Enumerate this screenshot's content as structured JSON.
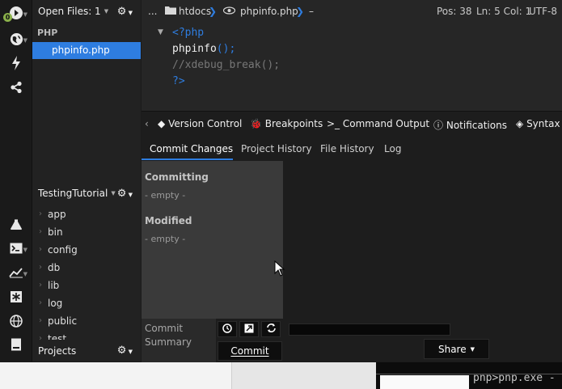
{
  "toolbar": {
    "badge": "0",
    "icons": [
      "php-toggle-icon",
      "globe-icon",
      "lightning-icon",
      "share-icon",
      "flask-icon",
      "terminal-icon",
      "chart-icon",
      "asterisk-icon",
      "globe-icon",
      "book-icon"
    ]
  },
  "left_panel": {
    "open_files_label": "Open Files: 1",
    "section_label": "PHP",
    "open_file": "phpinfo.php",
    "project_label": "TestingTutorial",
    "tree": [
      "app",
      "bin",
      "config",
      "db",
      "lib",
      "log",
      "public",
      "test"
    ],
    "projects_label": "Projects"
  },
  "editor": {
    "breadcrumb": {
      "ellipsis": "...",
      "folder": "htdocs",
      "file": "phpinfo.php",
      "dash": "–"
    },
    "status": {
      "pos": "Pos: 38",
      "ln_col": "Ln: 5 Col: 1",
      "encoding": "UTF-8"
    },
    "code": [
      "<?php",
      "phpinfo",
      "();",
      "//xdebug_break();",
      "?>"
    ]
  },
  "bottom_panel": {
    "tabs": [
      "Version Control",
      "Breakpoints",
      "Command Output",
      "Notifications",
      "Syntax C"
    ],
    "subtabs": [
      "Commit Changes",
      "Project History",
      "File History",
      "Log"
    ],
    "committing_label": "Committing",
    "committing_empty": "- empty -",
    "modified_label": "Modified",
    "modified_empty": "- empty -",
    "commit_summary_line1": "Commit",
    "commit_summary_line2": "Summary",
    "commit_button": "Commit",
    "share_button": "Share"
  },
  "bottom_strip": {
    "console_text": "pnp>pnp.exe -"
  },
  "colors": {
    "accent": "#2e7de0",
    "php_tag": "#2e7de0",
    "comment": "#777777"
  }
}
